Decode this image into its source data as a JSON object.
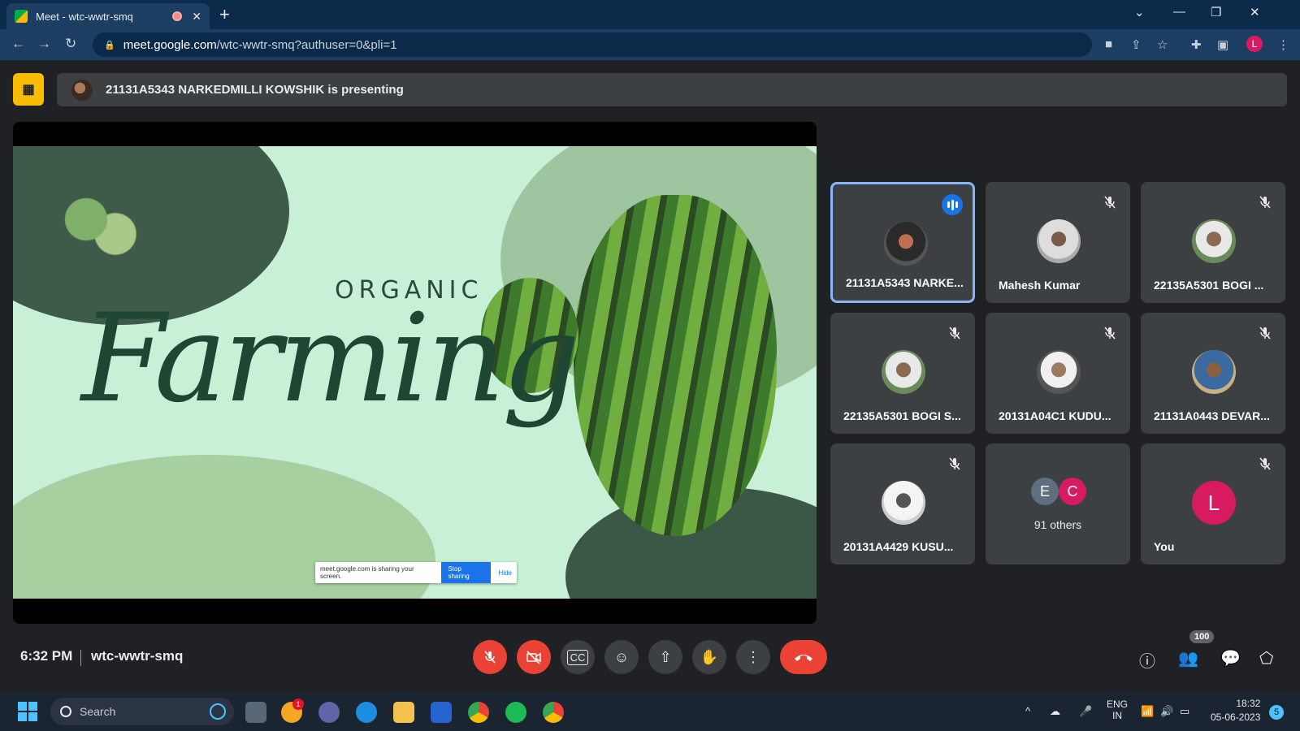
{
  "browser": {
    "tab_title": "Meet - wtc-wwtr-smq",
    "url_host": "meet.google.com",
    "url_path": "/wtc-wwtr-smq?authuser=0&pli=1",
    "profile_initial": "L"
  },
  "presenting": {
    "text": "21131A5343 NARKEDMILLI KOWSHIK is presenting"
  },
  "slide": {
    "eyebrow": "ORGANIC",
    "title": "Farming",
    "share_notice": "meet.google.com is sharing your screen.",
    "stop_label": "Stop sharing",
    "hide_label": "Hide"
  },
  "participants": [
    {
      "name": "21131A5343 NARKE...",
      "muted": false,
      "speaking": true
    },
    {
      "name": "Mahesh Kumar",
      "muted": true
    },
    {
      "name": "22135A5301 BOGI ...",
      "muted": true
    },
    {
      "name": "22135A5301 BOGI S...",
      "muted": true
    },
    {
      "name": "20131A04C1 KUDU...",
      "muted": true
    },
    {
      "name": "21131A0443 DEVAR...",
      "muted": true
    },
    {
      "name": "20131A4429 KUSU...",
      "muted": true
    },
    {
      "others_label": "91 others",
      "initials": [
        "E",
        "C"
      ]
    },
    {
      "name": "You",
      "initial": "L",
      "muted": true
    }
  ],
  "meeting": {
    "time": "6:32 PM",
    "code": "wtc-wwtr-smq",
    "participant_count": "100"
  },
  "taskbar": {
    "search_placeholder": "Search",
    "lang_line1": "ENG",
    "lang_line2": "IN",
    "clock_time": "18:32",
    "clock_date": "05-06-2023",
    "notifications": "5",
    "app_badge": "1"
  },
  "colors": {
    "accent": "#1a73e8",
    "danger": "#ea4335",
    "tile_bg": "#3c4043",
    "present_yellow": "#fbbc04",
    "you_avatar": "#d81b60"
  }
}
